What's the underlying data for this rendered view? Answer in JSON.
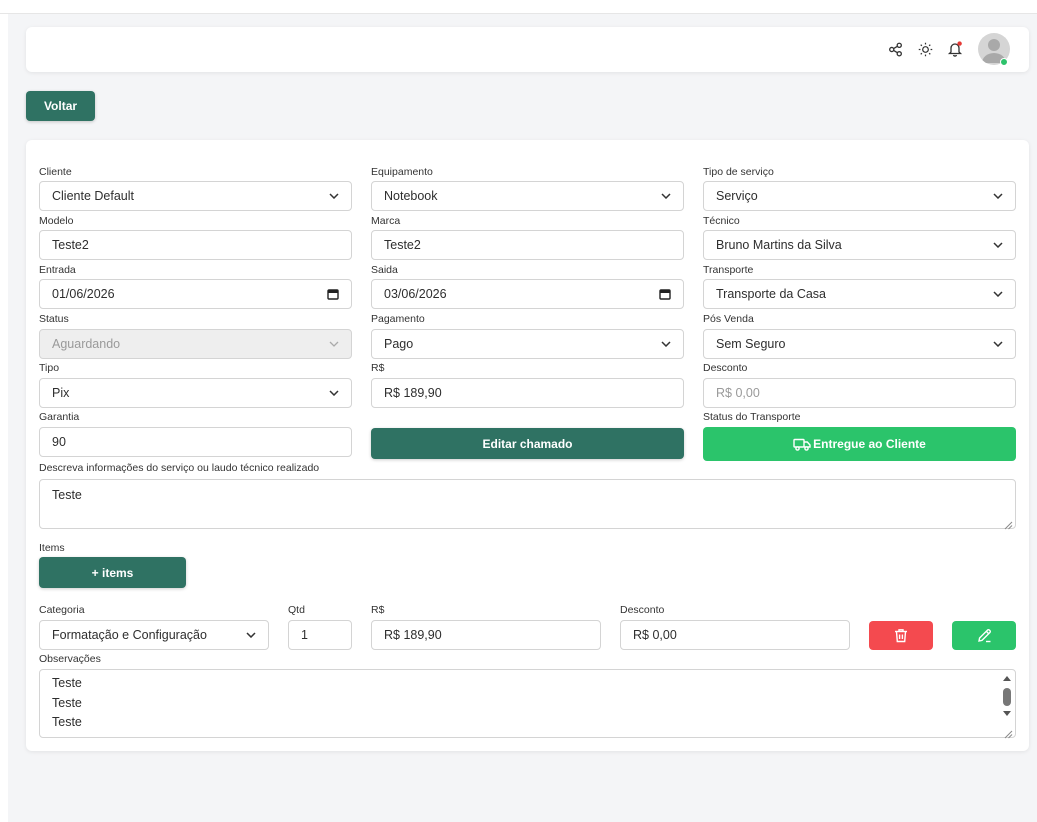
{
  "toolbar": {
    "back_label": "Voltar"
  },
  "form": {
    "cliente": {
      "label": "Cliente",
      "value": "Cliente Default"
    },
    "equipamento": {
      "label": "Equipamento",
      "value": "Notebook"
    },
    "tipo_servico": {
      "label": "Tipo de serviço",
      "value": "Serviço"
    },
    "modelo": {
      "label": "Modelo",
      "value": "Teste2"
    },
    "marca": {
      "label": "Marca",
      "value": "Teste2"
    },
    "tecnico": {
      "label": "Técnico",
      "value": "Bruno Martins da Silva"
    },
    "entrada": {
      "label": "Entrada",
      "value": "01/06/2026"
    },
    "saida": {
      "label": "Saida",
      "value": "03/06/2026"
    },
    "transporte": {
      "label": "Transporte",
      "value": "Transporte da Casa"
    },
    "status": {
      "label": "Status",
      "value": "Aguardando"
    },
    "pagamento": {
      "label": "Pagamento",
      "value": "Pago"
    },
    "pos_venda": {
      "label": "Pós Venda",
      "value": "Sem Seguro"
    },
    "tipo": {
      "label": "Tipo",
      "value": "Pix"
    },
    "valor": {
      "label": "R$",
      "value": "R$ 189,90"
    },
    "desconto": {
      "label": "Desconto",
      "placeholder": "R$ 0,00"
    },
    "garantia": {
      "label": "Garantia",
      "value": "90"
    },
    "editar_label": "Editar chamado",
    "status_transporte": {
      "label": "Status do Transporte",
      "button": "Entregue ao Cliente"
    },
    "descricao": {
      "label": "Descreva informações do serviço ou laudo técnico realizado",
      "value": "Teste"
    }
  },
  "items": {
    "label": "Items",
    "add_label": "+ items",
    "row": {
      "categoria": {
        "label": "Categoria",
        "value": "Formatação e Configuração"
      },
      "qtd": {
        "label": "Qtd",
        "value": "1"
      },
      "valor": {
        "label": "R$",
        "value": "R$ 189,90"
      },
      "desconto": {
        "label": "Desconto",
        "value": "R$ 0,00"
      }
    },
    "observacoes": {
      "label": "Observações",
      "lines": [
        "Teste",
        "Teste",
        "Teste"
      ]
    }
  },
  "colors": {
    "primary": "#2f7263",
    "success": "#2bc46b",
    "danger": "#f44a4f",
    "notification_dot": "#e53935",
    "online": "#2dc26b"
  },
  "icons": {
    "navbar": [
      "share-icon",
      "sun-icon",
      "bell-icon",
      "avatar"
    ],
    "transport_button": "truck-icon",
    "delete": "trash-icon",
    "edit": "pencil-icon"
  }
}
